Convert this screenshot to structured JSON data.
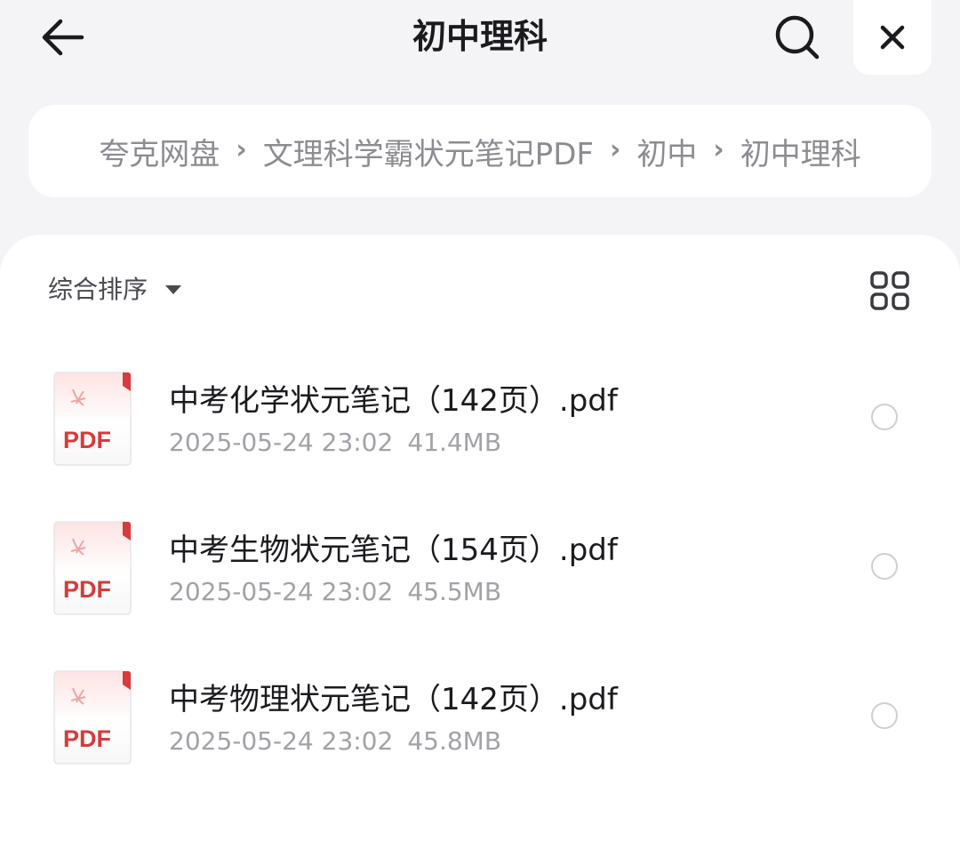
{
  "header": {
    "title": "初中理科",
    "back_icon": "arrow-left-icon",
    "search_icon": "search-icon",
    "close_icon": "close-icon"
  },
  "breadcrumb": [
    "夸克网盘",
    "文理科学霸状元笔记PDF",
    "初中",
    "初中理科"
  ],
  "toolbar": {
    "sort_label": "综合排序",
    "grid_icon": "grid-view-icon"
  },
  "files": [
    {
      "name": "中考化学状元笔记（142页）.pdf",
      "date": "2025-05-24 23:02",
      "size": "41.4MB",
      "type_label": "PDF"
    },
    {
      "name": "中考生物状元笔记（154页）.pdf",
      "date": "2025-05-24 23:02",
      "size": "45.5MB",
      "type_label": "PDF"
    },
    {
      "name": "中考物理状元笔记（142页）.pdf",
      "date": "2025-05-24 23:02",
      "size": "45.8MB",
      "type_label": "PDF"
    }
  ],
  "colors": {
    "background": "#f4f4f6",
    "pdf_red": "#d93a3a",
    "text_primary": "#1b1b1f",
    "text_secondary": "#a2a2a8"
  }
}
